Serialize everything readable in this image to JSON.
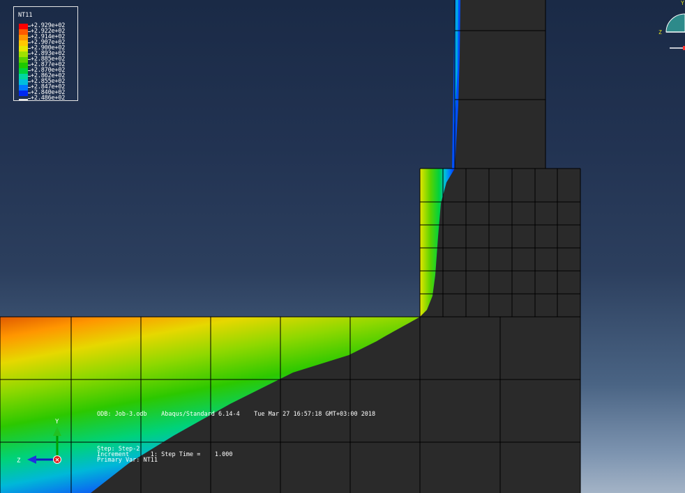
{
  "legend": {
    "title": "NT11",
    "entries": [
      {
        "value": "+2.929e+02",
        "color": "#ff0000"
      },
      {
        "value": "+2.922e+02",
        "color": "#ff5a00"
      },
      {
        "value": "+2.914e+02",
        "color": "#ff9600"
      },
      {
        "value": "+2.907e+02",
        "color": "#ffc800"
      },
      {
        "value": "+2.900e+02",
        "color": "#e6e600"
      },
      {
        "value": "+2.893e+02",
        "color": "#a0e100"
      },
      {
        "value": "+2.885e+02",
        "color": "#5ad200"
      },
      {
        "value": "+2.877e+02",
        "color": "#1ec800"
      },
      {
        "value": "+2.870e+02",
        "color": "#00d23c"
      },
      {
        "value": "+2.862e+02",
        "color": "#00d7a0"
      },
      {
        "value": "+2.855e+02",
        "color": "#00bedc"
      },
      {
        "value": "+2.847e+02",
        "color": "#0078ff"
      },
      {
        "value": "+2.840e+02",
        "color": "#0028f0"
      },
      {
        "value": "+2.486e+02",
        "color": "#ffffff"
      }
    ]
  },
  "info": {
    "odb_line": "ODB: Job-3.odb    Abaqus/Standard 6.14-4    Tue Mar 27 16:57:18 GMT+03:00 2018",
    "step_line": "Step: Step-2",
    "increment_line": "Increment      1: Step Time =    1.000",
    "var_line": "Primary Var: NT11"
  },
  "triad": {
    "y_label": "Y",
    "z_label": "Z"
  },
  "view_cube": {
    "y_label": "Y",
    "z_label": "Z"
  },
  "colors": {
    "mesh_fill": "#2a2a2a",
    "mesh_line": "#000000",
    "red": "#ff0000",
    "orange": "#ff8c00",
    "yellow": "#e6e600",
    "green": "#3cc800",
    "cyan": "#00c8c8",
    "blue": "#0028f0"
  }
}
